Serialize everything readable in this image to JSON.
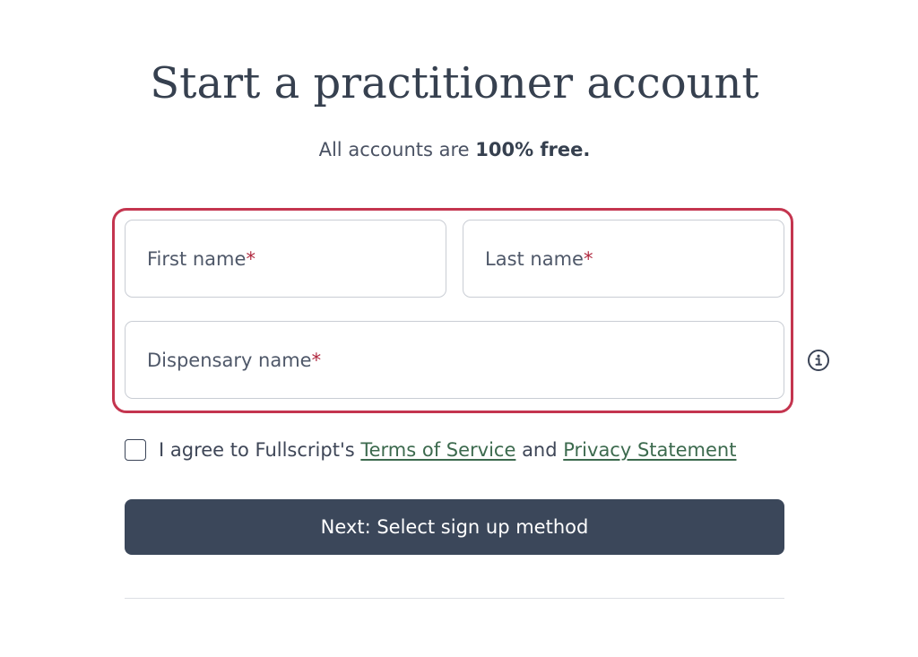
{
  "header": {
    "title": "Start a practitioner account",
    "subtitle_prefix": "All accounts are ",
    "subtitle_emphasis": "100% free."
  },
  "form": {
    "first_name": {
      "placeholder": "First name",
      "required_mark": "*",
      "value": ""
    },
    "last_name": {
      "placeholder": "Last name",
      "required_mark": "*",
      "value": ""
    },
    "dispensary_name": {
      "placeholder": "Dispensary name",
      "required_mark": "*",
      "value": ""
    },
    "info_icon": "info-icon",
    "agreement": {
      "checked": false,
      "prefix": "I agree to Fullscript's ",
      "terms_link": "Terms of Service",
      "conjunction": " and ",
      "privacy_link": "Privacy Statement"
    },
    "next_button_label": "Next: Select sign up method"
  },
  "colors": {
    "error_border": "#c4354f",
    "required_mark": "#b0283f",
    "link": "#3c6a4e",
    "button_bg": "#3b475a"
  }
}
